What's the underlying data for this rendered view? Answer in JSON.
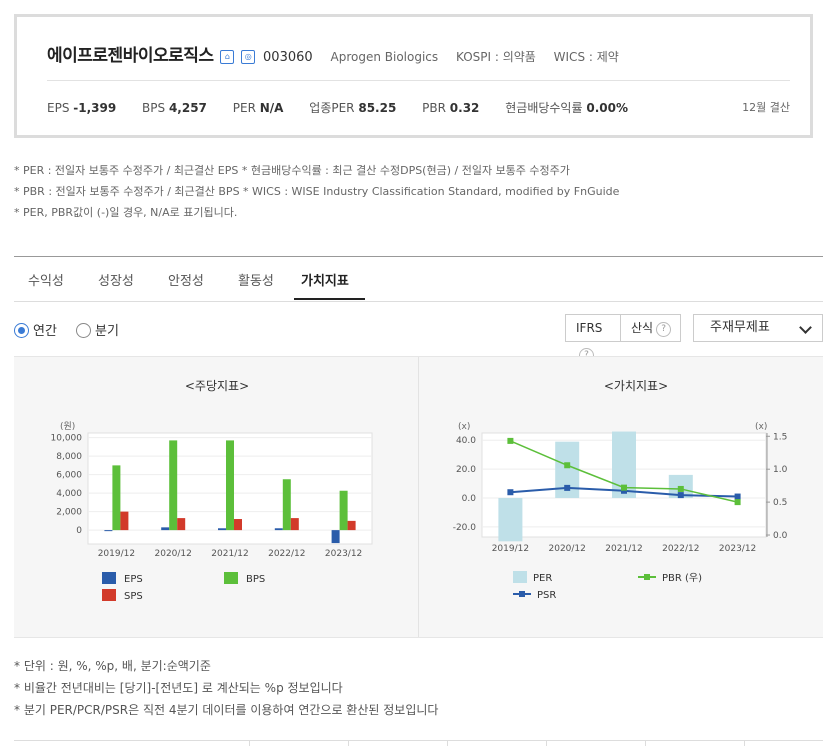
{
  "header": {
    "company_name": "에이프로젠바이오로직스",
    "icon1": "home-icon",
    "icon2": "company-icon",
    "code": "003060",
    "english_name": "Aprogen Biologics",
    "market": "KOSPI : 의약품",
    "wics": "WICS : 제약",
    "metrics": [
      {
        "label": "EPS",
        "value": "-1,399"
      },
      {
        "label": "BPS",
        "value": "4,257"
      },
      {
        "label": "PER",
        "value": "N/A"
      },
      {
        "label": "업종PER",
        "value": "85.25"
      },
      {
        "label": "PBR",
        "value": "0.32"
      },
      {
        "label": "현금배당수익률",
        "value": "0.00%"
      }
    ],
    "fiscal_month": "12월 결산"
  },
  "notes_top": [
    "* PER : 전일자 보통주 수정주가 / 최근결산 EPS * 현금배당수익률 : 최근 결산 수정DPS(현금) / 전일자 보통주 수정주가",
    "* PBR : 전일자 보통주 수정주가 / 최근결산 BPS * WICS : WISE Industry Classification Standard, modified by FnGuide",
    "* PER, PBR값이 (-)일 경우, N/A로 표기됩니다."
  ],
  "tabs": [
    {
      "label": "수익성"
    },
    {
      "label": "성장성"
    },
    {
      "label": "안정성"
    },
    {
      "label": "활동성"
    },
    {
      "label": "가치지표",
      "active": true
    }
  ],
  "period": {
    "annual": "연간",
    "quarter": "분기",
    "selected": "annual"
  },
  "controls": {
    "ifrs": "IFRS",
    "calc": "산식",
    "dropdown": "주재무제표"
  },
  "chart_data": [
    {
      "type": "bar",
      "title": "<주당지표>",
      "unit_label": "(원)",
      "categories": [
        "2019/12",
        "2020/12",
        "2021/12",
        "2022/12",
        "2023/12"
      ],
      "ylim": [
        -1500,
        10500
      ],
      "yticks": [
        "10,000",
        "8,000",
        "6,000",
        "4,000",
        "2,000",
        "0"
      ],
      "series": [
        {
          "name": "EPS",
          "color": "#2a5caa",
          "values": [
            -100,
            300,
            200,
            200,
            -1399
          ]
        },
        {
          "name": "BPS",
          "color": "#5cbf3a",
          "values": [
            7000,
            9700,
            9700,
            5500,
            4257
          ]
        },
        {
          "name": "SPS",
          "color": "#d23a2a",
          "values": [
            2000,
            1300,
            1200,
            1300,
            1000
          ]
        }
      ],
      "grid": true,
      "legend": "bottom"
    },
    {
      "type": "bar+line",
      "title": "<가치지표>",
      "left_unit": "(x)",
      "right_unit": "(x)",
      "categories": [
        "2019/12",
        "2020/12",
        "2021/12",
        "2022/12",
        "2023/12"
      ],
      "left_ylim": [
        -27,
        45
      ],
      "left_yticks": [
        "40.0",
        "20.0",
        "0.0",
        "-20.0"
      ],
      "right_ylim": [
        -0.03,
        1.55
      ],
      "right_yticks": [
        "1.5",
        "1.0",
        "0.5",
        "0.0"
      ],
      "series": [
        {
          "name": "PER",
          "axis": "left",
          "kind": "bar",
          "color": "#bfe0e8",
          "values": [
            -30,
            39,
            46,
            16,
            0
          ]
        },
        {
          "name": "PSR",
          "axis": "left",
          "kind": "line",
          "color": "#2a5caa",
          "values": [
            4,
            7,
            5,
            2,
            1
          ]
        },
        {
          "name": "PBR (우)",
          "axis": "right",
          "kind": "line",
          "color": "#5cbf3a",
          "values": [
            1.43,
            1.06,
            0.72,
            0.7,
            0.5
          ]
        }
      ],
      "grid": true,
      "legend": "bottom"
    }
  ],
  "notes_bottom": [
    "* 단위 : 원, %, %p, 배, 분기:순액기준",
    "* 비율간 전년대비는 [당기]-[전년도] 로 계산되는 %p 정보입니다",
    "* 분기 PER/PCR/PSR은 직전 4분기 데이터를 이용하여 연간으로 환산된 정보입니다"
  ]
}
